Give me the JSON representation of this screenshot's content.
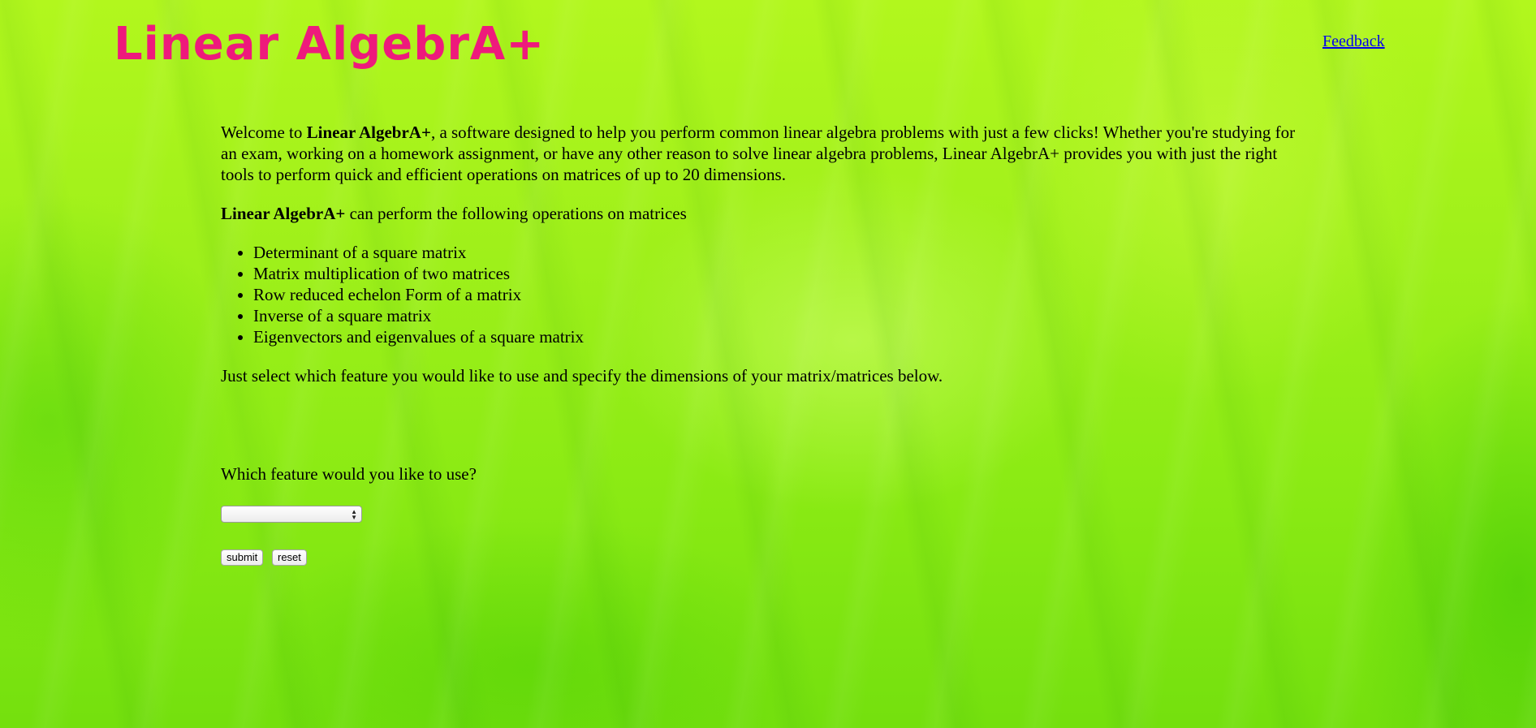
{
  "header": {
    "logo_text": "Linear AlgebrA+",
    "feedback_link": "Feedback"
  },
  "intro": {
    "welcome_prefix": "Welcome to ",
    "brand": "Linear AlgebrA+",
    "welcome_suffix": ", a software designed to help you perform common linear algebra problems with just a few clicks! Whether you're studying for an exam, working on a homework assignment, or have any other reason to solve linear algebra problems, Linear AlgebrA+ provides you with just the right tools to perform quick and efficient operations on matrices of up to 20 dimensions.",
    "operations_brand": "Linear AlgebrA+",
    "operations_suffix": " can perform the following operations on matrices",
    "operations": [
      "Determinant of a square matrix",
      "Matrix multiplication of two matrices",
      "Row reduced echelon Form of a matrix",
      "Inverse of a square matrix",
      "Eigenvectors and eigenvalues of a square matrix"
    ],
    "instructions": "Just select which feature you would like to use and specify the dimensions of your matrix/matrices below."
  },
  "form": {
    "question": "Which feature would you like to use?",
    "feature_select_value": "",
    "submit_label": "submit",
    "reset_label": "reset"
  },
  "colors": {
    "logo": "#ee1a7c",
    "link": "#0000ee",
    "background": "#9ff01a"
  },
  "icons": {
    "select_arrows": "updown-arrows-icon"
  }
}
